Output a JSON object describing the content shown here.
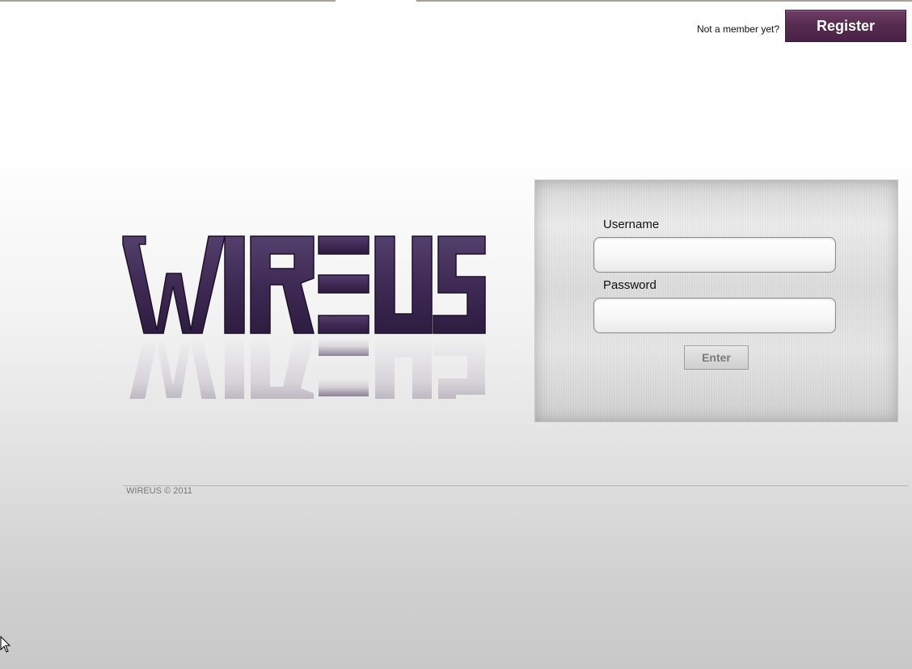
{
  "header": {
    "member_prompt": "Not a member yet?",
    "register_label": "Register"
  },
  "logo": {
    "text": "WIREUS",
    "color": "#3f2a55"
  },
  "login": {
    "username_label": "Username",
    "username_value": "",
    "password_label": "Password",
    "password_value": "",
    "enter_label": "Enter"
  },
  "footer": {
    "copyright": "WIREUS © 2011"
  },
  "colors": {
    "brand_purple": "#562a50",
    "logo_purple": "#3f2a55"
  },
  "icons": {
    "cursor": "mouse-pointer-icon"
  }
}
